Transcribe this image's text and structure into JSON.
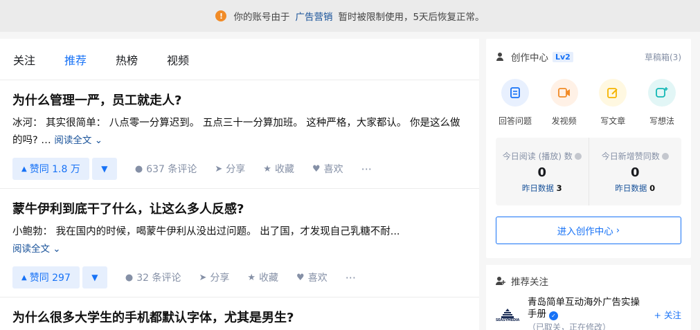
{
  "notice": {
    "before": "你的账号由于",
    "link": "广告营销",
    "after": "暂时被限制使用，5天后恢复正常。"
  },
  "tabs": [
    {
      "label": "关注"
    },
    {
      "label": "推荐",
      "active": true
    },
    {
      "label": "热榜"
    },
    {
      "label": "视频"
    }
  ],
  "feed": [
    {
      "title": "为什么管理一严，员工就走人?",
      "excerpt": "冰河： 其实很简单： 八点零一分算迟到。 五点三十一分算加班。 这种严格，大家都认。 你是这么做的吗? …",
      "read_more": "阅读全文",
      "vote": "赞同 1.8 万",
      "comments": "637 条评论",
      "share": "分享",
      "collect": "收藏",
      "like": "喜欢"
    },
    {
      "title": "蒙牛伊利到底干了什么，让这么多人反感?",
      "excerpt": "小鲍勃： 我在国内的时候，喝蒙牛伊利从没出过问题。 出了国，才发现自己乳糖不耐...",
      "read_more": "阅读全文",
      "vote": "赞同 297",
      "comments": "32 条评论",
      "share": "分享",
      "collect": "收藏",
      "like": "喜欢"
    },
    {
      "title": "为什么很多大学生的手机都默认字体，尤其是男生?"
    }
  ],
  "creator": {
    "title": "创作中心",
    "level": "Lv2",
    "drafts": "草稿箱(3)",
    "tools": [
      {
        "label": "回答问题",
        "icon": "answer-icon",
        "bg": "#e8f0fe",
        "fg": "#1772f6"
      },
      {
        "label": "发视频",
        "icon": "video-icon",
        "bg": "#fff1e6",
        "fg": "#f18b27"
      },
      {
        "label": "写文章",
        "icon": "write-icon",
        "bg": "#fff8e1",
        "fg": "#f5b400"
      },
      {
        "label": "写想法",
        "icon": "idea-icon",
        "bg": "#e2f6f6",
        "fg": "#12b7b5"
      }
    ],
    "stats": [
      {
        "label": "今日阅读 (播放) 数",
        "value": "0",
        "yesterday_label": "昨日数据",
        "yesterday_value": "3"
      },
      {
        "label": "今日新增赞同数",
        "value": "0",
        "yesterday_label": "昨日数据",
        "yesterday_value": "0"
      }
    ],
    "enter": "进入创作中心"
  },
  "recommend": {
    "title": "推荐关注",
    "item": {
      "name": "青岛简单互动海外广告实操手册",
      "desc": "（已取关，正在修改）",
      "follow": "+ 关注",
      "logo_text": "SEASYMEDIA"
    }
  },
  "colors": {
    "accent": "#1772f6",
    "warning": "#f18b27",
    "meta": "#8590a6"
  }
}
